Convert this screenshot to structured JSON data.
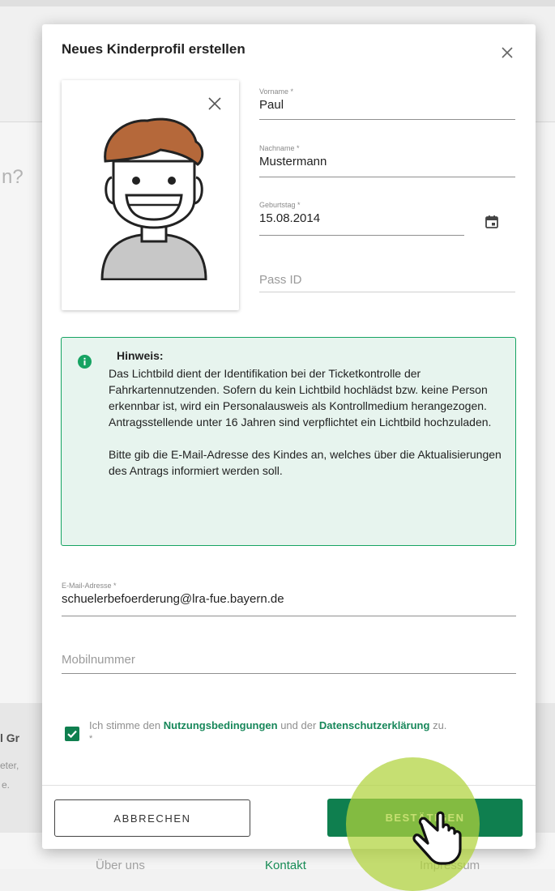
{
  "background": {
    "fragment_question": "n?",
    "fragment_heading": "l Gr",
    "fragment_line1": "eter,",
    "fragment_line2": "e.",
    "footer_links": [
      "Über uns",
      "Kontakt",
      "Impressum"
    ]
  },
  "dialog": {
    "title": "Neues Kinderprofil erstellen",
    "close_icon": "close-icon",
    "photo": {
      "remove_icon": "close-icon",
      "avatar": "child-avatar-illustration"
    },
    "fields": {
      "vorname": {
        "label": "Vorname *",
        "value": "Paul"
      },
      "nachname": {
        "label": "Nachname *",
        "value": "Mustermann"
      },
      "geburtstag": {
        "label": "Geburtstag *",
        "value": "15.08.2014",
        "icon": "calendar-icon"
      },
      "pass_id": {
        "placeholder": "Pass ID"
      },
      "email": {
        "label": "E-Mail-Adresse *",
        "value": "schuelerbefoerderung@lra-fue.bayern.de"
      },
      "mobil": {
        "placeholder": "Mobilnummer"
      }
    },
    "notice": {
      "icon": "info-icon",
      "title": "Hinweis:",
      "text": "Das Lichtbild dient der Identifikation bei der Ticketkontrolle der Fahrkartennutzenden. Sofern du kein Lichtbild hochlädst bzw. keine Person erkennbar ist, wird ein Personalausweis als Kontrollmedium herangezogen.\nAntragsstellende unter 16 Jahren sind verpflichtet ein Lichtbild hochzuladen.\n\nBitte gib die E-Mail-Adresse des Kindes an, welches über die Aktualisierungen des Antrags informiert werden soll."
    },
    "terms": {
      "checked": true,
      "prefix": "Ich stimme den ",
      "link1": "Nutzungsbedingungen",
      "middle": " und der ",
      "link2": "Datenschutzerklärung",
      "suffix": " zu.",
      "required_mark": "*"
    },
    "buttons": {
      "cancel": "ABBRECHEN",
      "confirm": "BESTÄTIGEN"
    }
  },
  "colors": {
    "primary_green": "#0f7f4f",
    "notice_bg": "#e7f4ee",
    "notice_border": "#16a362",
    "click_highlight": "#b0d23c"
  }
}
